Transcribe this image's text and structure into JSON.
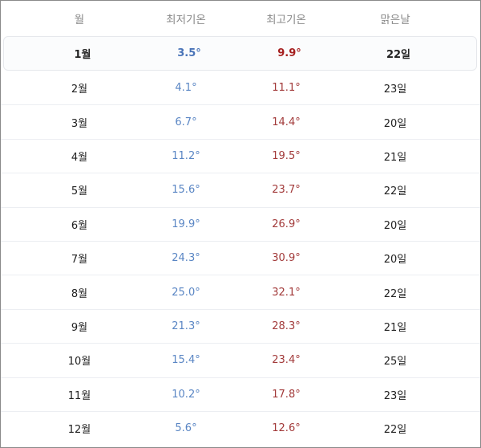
{
  "table": {
    "headers": [
      "월",
      "최저기온",
      "최고기온",
      "맑은날"
    ],
    "rows": [
      {
        "month": "1월",
        "low": "3.5°",
        "high": "9.9°",
        "sunny": "22일"
      },
      {
        "month": "2월",
        "low": "4.1°",
        "high": "11.1°",
        "sunny": "23일"
      },
      {
        "month": "3월",
        "low": "6.7°",
        "high": "14.4°",
        "sunny": "20일"
      },
      {
        "month": "4월",
        "low": "11.2°",
        "high": "19.5°",
        "sunny": "21일"
      },
      {
        "month": "5월",
        "low": "15.6°",
        "high": "23.7°",
        "sunny": "22일"
      },
      {
        "month": "6월",
        "low": "19.9°",
        "high": "26.9°",
        "sunny": "20일"
      },
      {
        "month": "7월",
        "low": "24.3°",
        "high": "30.9°",
        "sunny": "20일"
      },
      {
        "month": "8월",
        "low": "25.0°",
        "high": "32.1°",
        "sunny": "22일"
      },
      {
        "month": "9월",
        "low": "21.3°",
        "high": "28.3°",
        "sunny": "21일"
      },
      {
        "month": "10월",
        "low": "15.4°",
        "high": "23.4°",
        "sunny": "25일"
      },
      {
        "month": "11월",
        "low": "10.2°",
        "high": "17.8°",
        "sunny": "23일"
      },
      {
        "month": "12월",
        "low": "5.6°",
        "high": "12.6°",
        "sunny": "22일"
      }
    ]
  },
  "colors": {
    "low_temp": "#5a86c4",
    "high_temp": "#a23a3a",
    "header_text": "#8a8a8a"
  }
}
